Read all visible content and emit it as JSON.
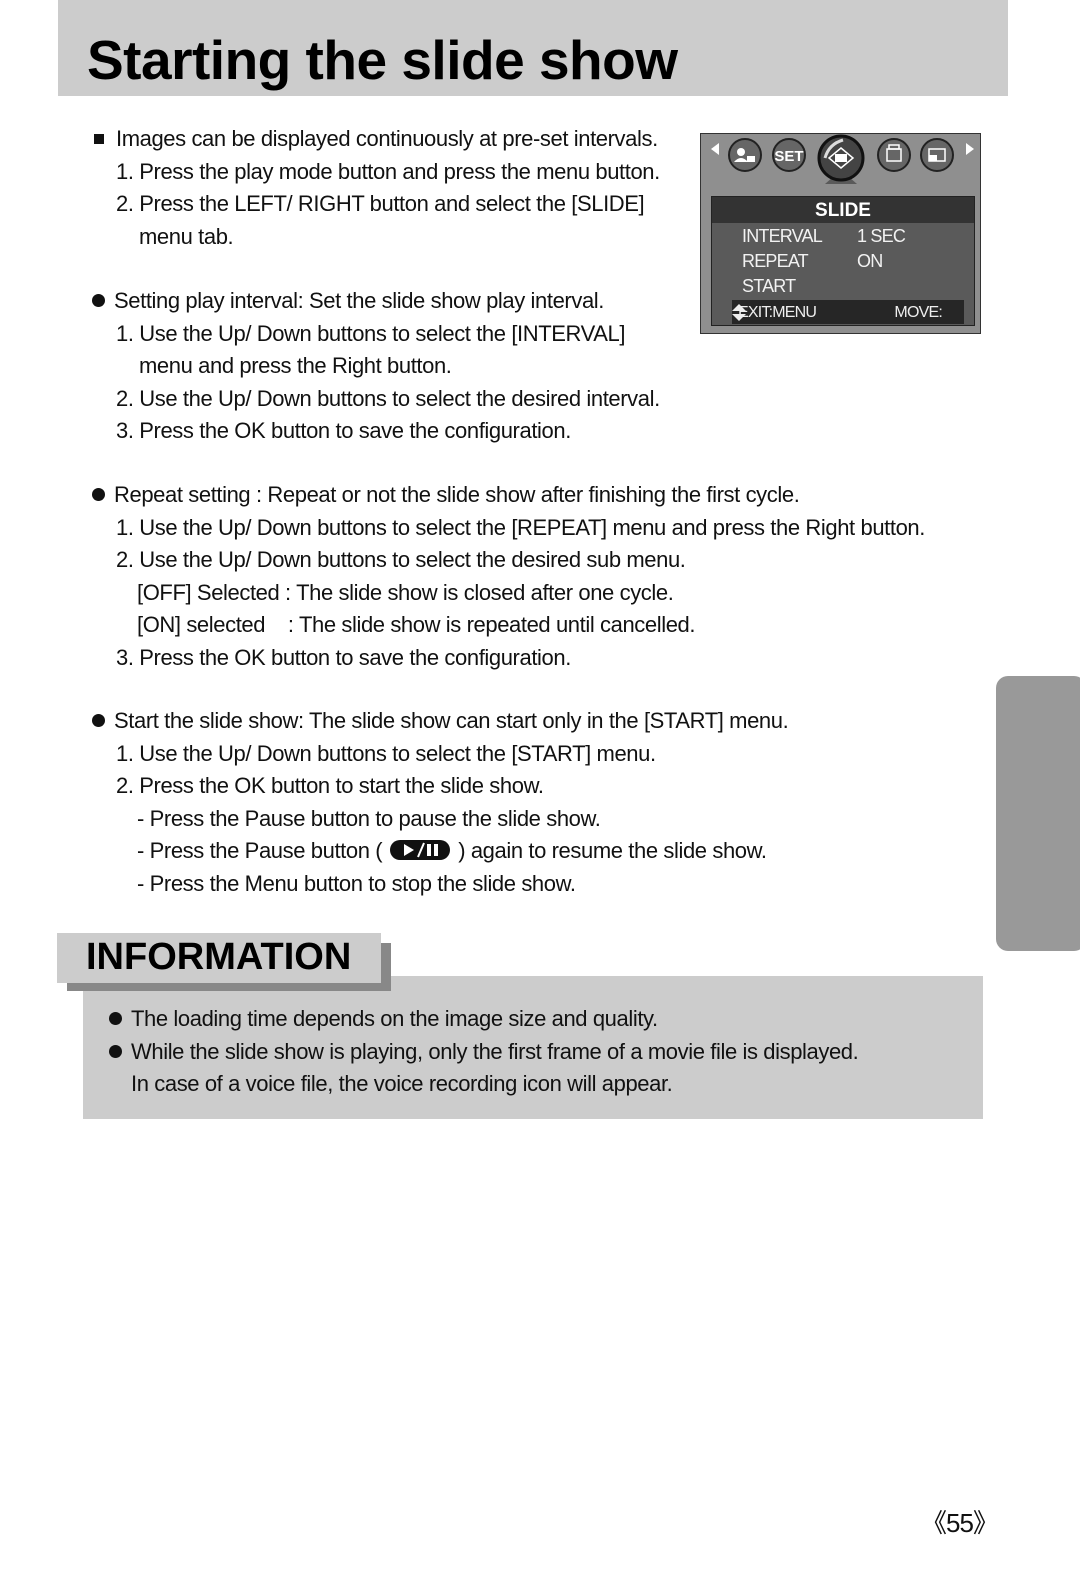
{
  "page": {
    "title": "Starting the slide show",
    "page_number": "《55》"
  },
  "intro": {
    "lead": "Images can be displayed continuously at pre-set intervals.",
    "steps": [
      "1. Press the play mode button and press the menu button.",
      "2. Press the LEFT/ RIGHT button and select the [SLIDE]",
      "menu tab."
    ]
  },
  "interval": {
    "lead": "Setting play interval: Set the slide show play interval.",
    "steps": [
      "1. Use the Up/ Down buttons to select the [INTERVAL]",
      "menu and press the Right button.",
      "2. Use the Up/ Down buttons to select the desired interval.",
      "3. Press the OK button to save the configuration."
    ]
  },
  "repeat": {
    "lead": "Repeat setting : Repeat or not the slide show after finishing the first cycle.",
    "steps": [
      "1. Use the Up/ Down buttons to select the [REPEAT] menu and press the Right button.",
      "2. Use the Up/ Down buttons to select the desired sub menu.",
      "[OFF] Selected : The slide show is closed after one cycle.",
      "[ON] selected    : The slide show is repeated until cancelled.",
      "3. Press the OK button to save the configuration."
    ]
  },
  "start": {
    "lead": "Start the slide show: The slide show can start only in the [START] menu.",
    "steps": [
      "1. Use the Up/ Down buttons to select the [START] menu.",
      "2. Press the OK button to start the slide show.",
      "- Press the Pause button to pause the slide show.",
      "- Press the Pause button (",
      ") again to resume the slide show.",
      "- Press the Menu button to stop the slide show."
    ]
  },
  "lcd_menu": {
    "tab_icons": [
      "protect-person-icon",
      "set-icon",
      "slide-icon",
      "print-icon",
      "resize-icon"
    ],
    "set_label": "SET",
    "header": "SLIDE",
    "rows": [
      {
        "label": "INTERVAL",
        "value": "1 SEC"
      },
      {
        "label": "REPEAT",
        "value": "ON"
      },
      {
        "label": "START",
        "value": ""
      }
    ],
    "footer_exit": "EXIT:MENU",
    "footer_move": "MOVE:"
  },
  "information": {
    "title": "INFORMATION",
    "items": [
      "The loading time depends on the image size and quality.",
      "While the slide show is playing, only the first frame of a movie file is displayed.",
      "In case of a voice file, the voice recording icon will appear."
    ]
  }
}
